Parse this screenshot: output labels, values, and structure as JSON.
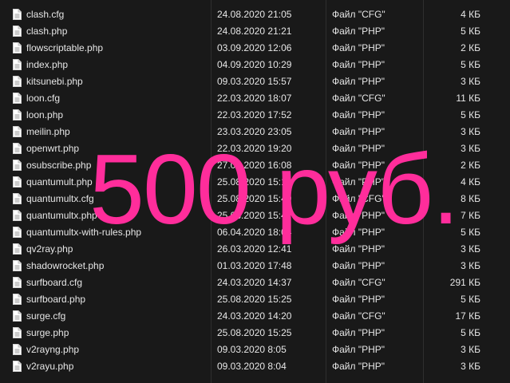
{
  "files": [
    {
      "name": "clash.cfg",
      "date": "24.08.2020 21:05",
      "type": "Файл \"CFG\"",
      "size": "4 КБ",
      "icon": "document-icon"
    },
    {
      "name": "clash.php",
      "date": "24.08.2020 21:21",
      "type": "Файл \"PHP\"",
      "size": "5 КБ",
      "icon": "document-icon"
    },
    {
      "name": "flowscriptable.php",
      "date": "03.09.2020 12:06",
      "type": "Файл \"PHP\"",
      "size": "2 КБ",
      "icon": "document-icon"
    },
    {
      "name": "index.php",
      "date": "04.09.2020 10:29",
      "type": "Файл \"PHP\"",
      "size": "5 КБ",
      "icon": "document-icon"
    },
    {
      "name": "kitsunebi.php",
      "date": "09.03.2020 15:57",
      "type": "Файл \"PHP\"",
      "size": "3 КБ",
      "icon": "document-icon"
    },
    {
      "name": "loon.cfg",
      "date": "22.03.2020 18:07",
      "type": "Файл \"CFG\"",
      "size": "11 КБ",
      "icon": "document-icon"
    },
    {
      "name": "loon.php",
      "date": "22.03.2020 17:52",
      "type": "Файл \"PHP\"",
      "size": "5 КБ",
      "icon": "document-icon"
    },
    {
      "name": "meilin.php",
      "date": "23.03.2020 23:05",
      "type": "Файл \"PHP\"",
      "size": "3 КБ",
      "icon": "document-icon"
    },
    {
      "name": "openwrt.php",
      "date": "22.03.2020 19:20",
      "type": "Файл \"PHP\"",
      "size": "3 КБ",
      "icon": "document-icon"
    },
    {
      "name": "osubscribe.php",
      "date": "27.05.2020 16:08",
      "type": "Файл \"PHP\"",
      "size": "2 КБ",
      "icon": "document-icon"
    },
    {
      "name": "quantumult.php",
      "date": "25.08.2020 15:15",
      "type": "Файл \"PHP\"",
      "size": "4 КБ",
      "icon": "document-icon"
    },
    {
      "name": "quantumultx.cfg",
      "date": "25.08.2020 15:49",
      "type": "Файл \"CFG\"",
      "size": "8 КБ",
      "icon": "document-icon"
    },
    {
      "name": "quantumultx.php",
      "date": "25.08.2020 15:47",
      "type": "Файл \"PHP\"",
      "size": "7 КБ",
      "icon": "document-icon"
    },
    {
      "name": "quantumultx-with-rules.php",
      "date": "06.04.2020 18:04",
      "type": "Файл \"PHP\"",
      "size": "5 КБ",
      "icon": "document-icon"
    },
    {
      "name": "qv2ray.php",
      "date": "26.03.2020 12:41",
      "type": "Файл \"PHP\"",
      "size": "3 КБ",
      "icon": "document-icon"
    },
    {
      "name": "shadowrocket.php",
      "date": "01.03.2020 17:48",
      "type": "Файл \"PHP\"",
      "size": "3 КБ",
      "icon": "document-icon"
    },
    {
      "name": "surfboard.cfg",
      "date": "24.03.2020 14:37",
      "type": "Файл \"CFG\"",
      "size": "291 КБ",
      "icon": "document-icon"
    },
    {
      "name": "surfboard.php",
      "date": "25.08.2020 15:25",
      "type": "Файл \"PHP\"",
      "size": "5 КБ",
      "icon": "document-icon"
    },
    {
      "name": "surge.cfg",
      "date": "24.03.2020 14:20",
      "type": "Файл \"CFG\"",
      "size": "17 КБ",
      "icon": "document-icon"
    },
    {
      "name": "surge.php",
      "date": "25.08.2020 15:25",
      "type": "Файл \"PHP\"",
      "size": "5 КБ",
      "icon": "document-icon"
    },
    {
      "name": "v2rayng.php",
      "date": "09.03.2020 8:05",
      "type": "Файл \"PHP\"",
      "size": "3 КБ",
      "icon": "document-icon"
    },
    {
      "name": "v2rayu.php",
      "date": "09.03.2020 8:04",
      "type": "Файл \"PHP\"",
      "size": "3 КБ",
      "icon": "document-icon"
    }
  ],
  "overlay": {
    "price_text": "500 руб.",
    "color": "#ff2d9b"
  },
  "colors": {
    "background": "#191919",
    "text": "#e6e6e6"
  }
}
